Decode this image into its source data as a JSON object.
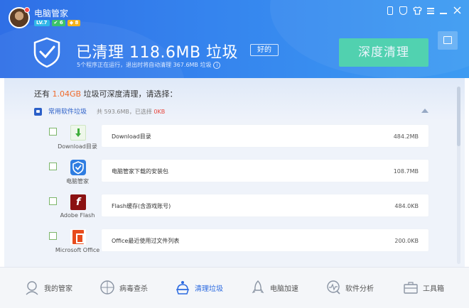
{
  "app": {
    "title": "电脑管家",
    "badges": [
      "LV.7",
      "✔ 6",
      "◆ 8"
    ]
  },
  "header": {
    "headline": "已清理 118.6MB 垃圾",
    "rating": "好的",
    "subline": "5个程序正在运行，退出时将自动清理 367.6MB 垃圾",
    "info_glyph": "i",
    "deep_clean_label": "深度清理"
  },
  "content": {
    "prompt_prefix": "还有 ",
    "prompt_amount": "1.04GB",
    "prompt_suffix": " 垃圾可深度清理，请选择：",
    "category": {
      "title": "常用软件垃圾",
      "stats_prefix": "共 593.6MB，已选择 ",
      "stats_selected": "0KB"
    },
    "rows": [
      {
        "app": "Download目录",
        "label": "Download目录",
        "size": "484.2MB",
        "icon": "download-icon"
      },
      {
        "app": "电脑管家",
        "label": "电脑管家下载的安装包",
        "size": "108.7MB",
        "icon": "pc-manager-icon"
      },
      {
        "app": "Adobe Flash",
        "label": "Flash缓存(含游戏账号)",
        "size": "484.0KB",
        "icon": "flash-icon",
        "glyph": "f"
      },
      {
        "app": "Microsoft Office",
        "label": "Office最近使用过文件列表",
        "size": "200.0KB",
        "icon": "office-icon"
      }
    ]
  },
  "nav": [
    {
      "label": "我的管家",
      "icon": "my-manager-icon",
      "active": false
    },
    {
      "label": "病毒查杀",
      "icon": "virus-scan-icon",
      "active": false
    },
    {
      "label": "清理垃圾",
      "icon": "cleanup-icon",
      "active": true
    },
    {
      "label": "电脑加速",
      "icon": "rocket-icon",
      "active": false
    },
    {
      "label": "软件分析",
      "icon": "software-analysis-icon",
      "active": false
    },
    {
      "label": "工具箱",
      "icon": "toolbox-icon",
      "active": false
    }
  ],
  "colors": {
    "header": "#3584ee",
    "accent_orange": "#f06a2a",
    "accent_red": "#e8443a",
    "deep_clean": "#53d8a9",
    "active_nav": "#2b6ae0"
  }
}
